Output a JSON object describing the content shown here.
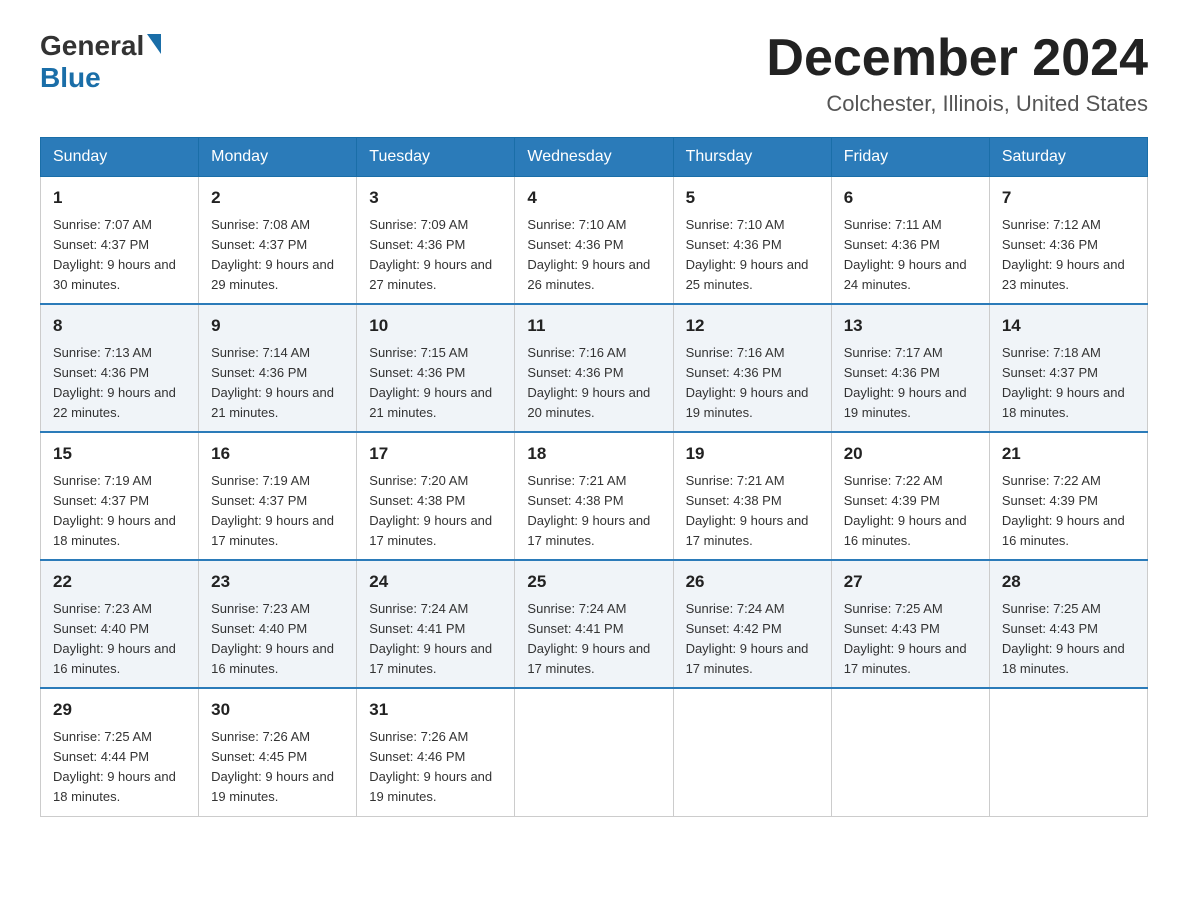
{
  "logo": {
    "general": "General",
    "blue": "Blue"
  },
  "title": "December 2024",
  "location": "Colchester, Illinois, United States",
  "headers": [
    "Sunday",
    "Monday",
    "Tuesday",
    "Wednesday",
    "Thursday",
    "Friday",
    "Saturday"
  ],
  "weeks": [
    [
      {
        "day": "1",
        "sunrise": "7:07 AM",
        "sunset": "4:37 PM",
        "daylight": "9 hours and 30 minutes."
      },
      {
        "day": "2",
        "sunrise": "7:08 AM",
        "sunset": "4:37 PM",
        "daylight": "9 hours and 29 minutes."
      },
      {
        "day": "3",
        "sunrise": "7:09 AM",
        "sunset": "4:36 PM",
        "daylight": "9 hours and 27 minutes."
      },
      {
        "day": "4",
        "sunrise": "7:10 AM",
        "sunset": "4:36 PM",
        "daylight": "9 hours and 26 minutes."
      },
      {
        "day": "5",
        "sunrise": "7:10 AM",
        "sunset": "4:36 PM",
        "daylight": "9 hours and 25 minutes."
      },
      {
        "day": "6",
        "sunrise": "7:11 AM",
        "sunset": "4:36 PM",
        "daylight": "9 hours and 24 minutes."
      },
      {
        "day": "7",
        "sunrise": "7:12 AM",
        "sunset": "4:36 PM",
        "daylight": "9 hours and 23 minutes."
      }
    ],
    [
      {
        "day": "8",
        "sunrise": "7:13 AM",
        "sunset": "4:36 PM",
        "daylight": "9 hours and 22 minutes."
      },
      {
        "day": "9",
        "sunrise": "7:14 AM",
        "sunset": "4:36 PM",
        "daylight": "9 hours and 21 minutes."
      },
      {
        "day": "10",
        "sunrise": "7:15 AM",
        "sunset": "4:36 PM",
        "daylight": "9 hours and 21 minutes."
      },
      {
        "day": "11",
        "sunrise": "7:16 AM",
        "sunset": "4:36 PM",
        "daylight": "9 hours and 20 minutes."
      },
      {
        "day": "12",
        "sunrise": "7:16 AM",
        "sunset": "4:36 PM",
        "daylight": "9 hours and 19 minutes."
      },
      {
        "day": "13",
        "sunrise": "7:17 AM",
        "sunset": "4:36 PM",
        "daylight": "9 hours and 19 minutes."
      },
      {
        "day": "14",
        "sunrise": "7:18 AM",
        "sunset": "4:37 PM",
        "daylight": "9 hours and 18 minutes."
      }
    ],
    [
      {
        "day": "15",
        "sunrise": "7:19 AM",
        "sunset": "4:37 PM",
        "daylight": "9 hours and 18 minutes."
      },
      {
        "day": "16",
        "sunrise": "7:19 AM",
        "sunset": "4:37 PM",
        "daylight": "9 hours and 17 minutes."
      },
      {
        "day": "17",
        "sunrise": "7:20 AM",
        "sunset": "4:38 PM",
        "daylight": "9 hours and 17 minutes."
      },
      {
        "day": "18",
        "sunrise": "7:21 AM",
        "sunset": "4:38 PM",
        "daylight": "9 hours and 17 minutes."
      },
      {
        "day": "19",
        "sunrise": "7:21 AM",
        "sunset": "4:38 PM",
        "daylight": "9 hours and 17 minutes."
      },
      {
        "day": "20",
        "sunrise": "7:22 AM",
        "sunset": "4:39 PM",
        "daylight": "9 hours and 16 minutes."
      },
      {
        "day": "21",
        "sunrise": "7:22 AM",
        "sunset": "4:39 PM",
        "daylight": "9 hours and 16 minutes."
      }
    ],
    [
      {
        "day": "22",
        "sunrise": "7:23 AM",
        "sunset": "4:40 PM",
        "daylight": "9 hours and 16 minutes."
      },
      {
        "day": "23",
        "sunrise": "7:23 AM",
        "sunset": "4:40 PM",
        "daylight": "9 hours and 16 minutes."
      },
      {
        "day": "24",
        "sunrise": "7:24 AM",
        "sunset": "4:41 PM",
        "daylight": "9 hours and 17 minutes."
      },
      {
        "day": "25",
        "sunrise": "7:24 AM",
        "sunset": "4:41 PM",
        "daylight": "9 hours and 17 minutes."
      },
      {
        "day": "26",
        "sunrise": "7:24 AM",
        "sunset": "4:42 PM",
        "daylight": "9 hours and 17 minutes."
      },
      {
        "day": "27",
        "sunrise": "7:25 AM",
        "sunset": "4:43 PM",
        "daylight": "9 hours and 17 minutes."
      },
      {
        "day": "28",
        "sunrise": "7:25 AM",
        "sunset": "4:43 PM",
        "daylight": "9 hours and 18 minutes."
      }
    ],
    [
      {
        "day": "29",
        "sunrise": "7:25 AM",
        "sunset": "4:44 PM",
        "daylight": "9 hours and 18 minutes."
      },
      {
        "day": "30",
        "sunrise": "7:26 AM",
        "sunset": "4:45 PM",
        "daylight": "9 hours and 19 minutes."
      },
      {
        "day": "31",
        "sunrise": "7:26 AM",
        "sunset": "4:46 PM",
        "daylight": "9 hours and 19 minutes."
      },
      null,
      null,
      null,
      null
    ]
  ]
}
